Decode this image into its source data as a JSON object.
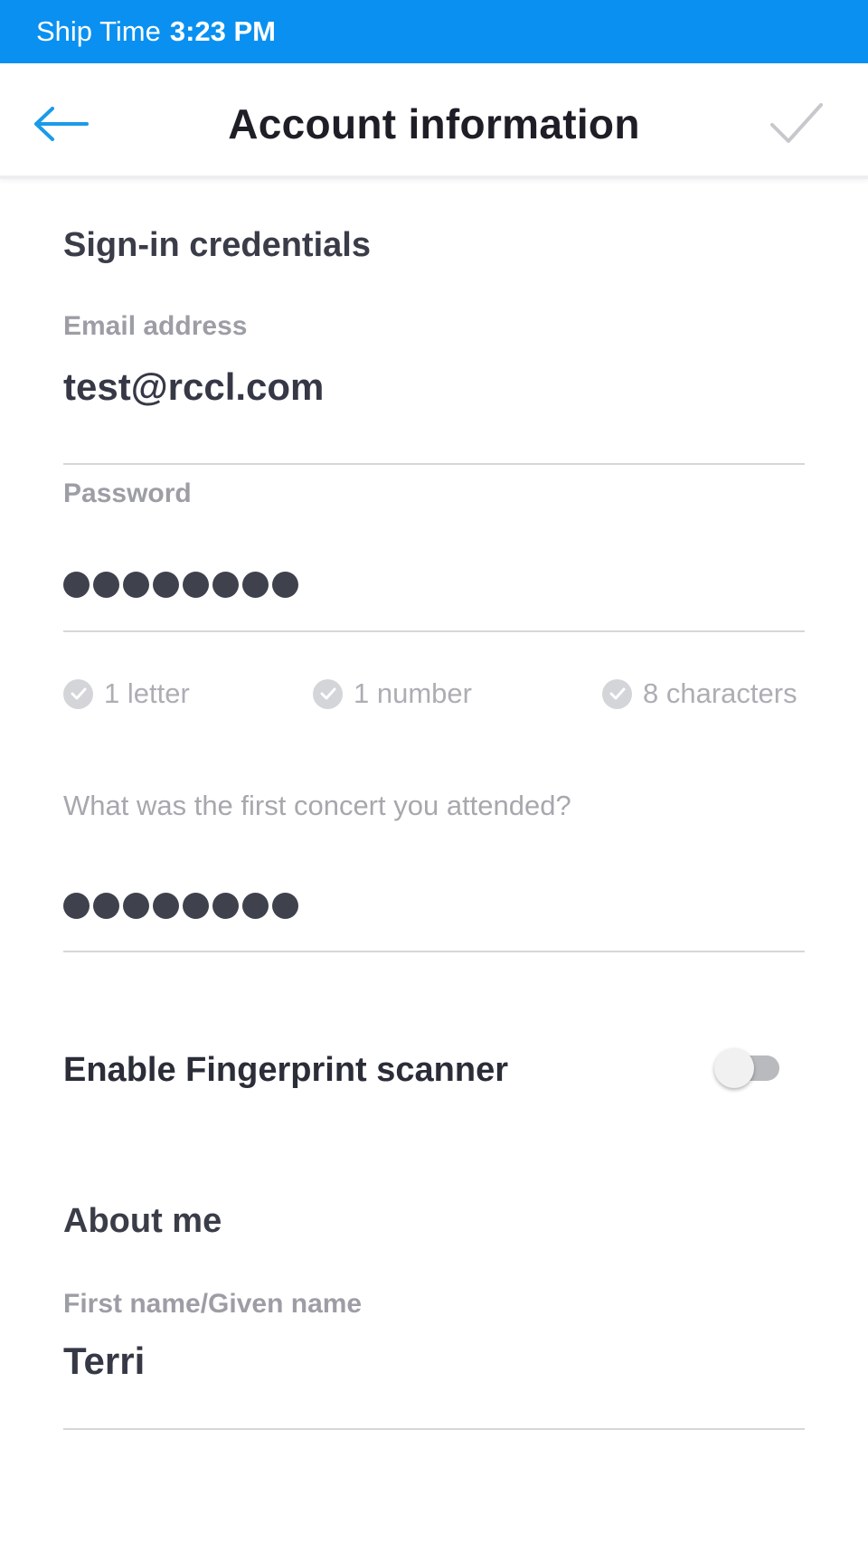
{
  "status_bar": {
    "label": "Ship Time",
    "time": "3:23 PM",
    "color": "#0a90f0"
  },
  "header": {
    "title": "Account information",
    "back_icon": "arrow-left-icon",
    "confirm_icon": "check-icon",
    "accent": "#1a9be8"
  },
  "sign_in": {
    "section_title": "Sign-in credentials",
    "email_label": "Email address",
    "email_value": "test@rccl.com",
    "password_label": "Password",
    "password_length": 8,
    "requirements": [
      {
        "label": "1 letter",
        "icon": "check-circle-icon"
      },
      {
        "label": "1 number",
        "icon": "check-circle-icon"
      },
      {
        "label": "8 characters",
        "icon": "check-circle-icon"
      }
    ],
    "security_question": "What was the first concert you attended?",
    "security_answer_length": 8
  },
  "fingerprint": {
    "label": "Enable Fingerprint scanner",
    "enabled": false
  },
  "about_me": {
    "section_title": "About me",
    "first_name_label": "First name/Given name",
    "first_name_value": "Terri"
  }
}
